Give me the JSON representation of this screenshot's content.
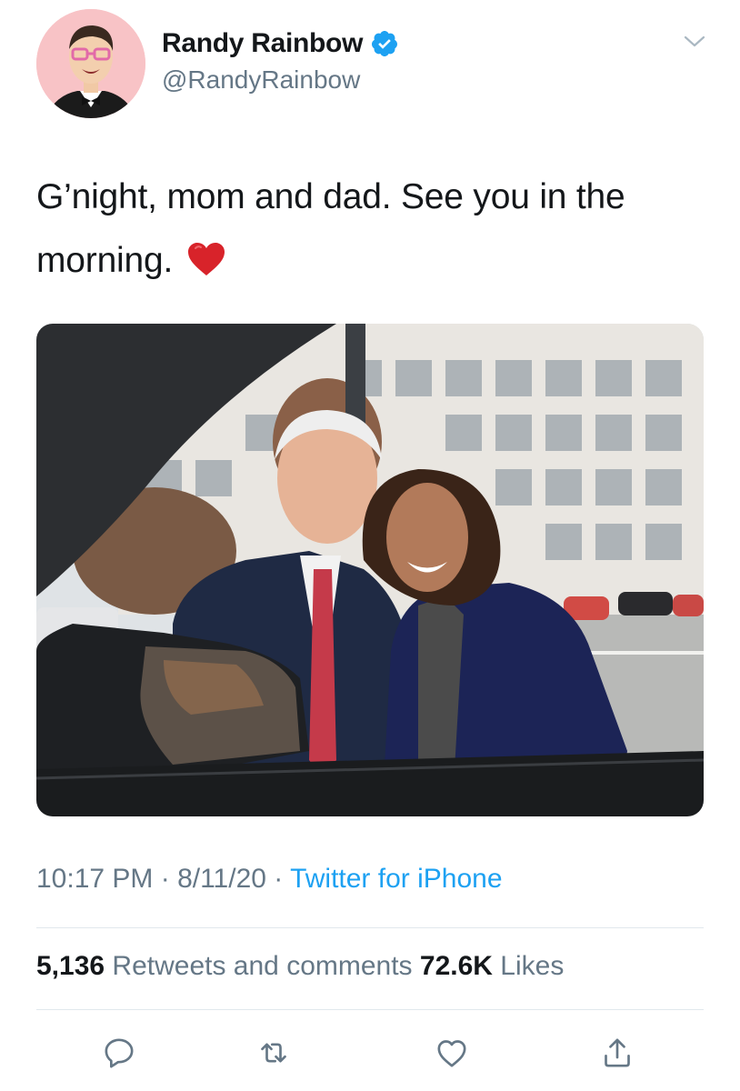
{
  "author": {
    "display_name": "Randy Rainbow",
    "handle": "@RandyRainbow",
    "verified": true
  },
  "tweet": {
    "text": "G’night, mom and dad. See you in the morning.",
    "emoji": "heart-emoji",
    "timestamp": "10:17 PM · 8/11/20 · ",
    "source": "Twitter for iPhone"
  },
  "stats": {
    "retweets_count": "5,136",
    "retweets_label": " Retweets and comments ",
    "likes_count": "72.6K",
    "likes_label": " Likes"
  },
  "actions": [
    {
      "name": "reply",
      "icon": "reply-icon"
    },
    {
      "name": "retweet",
      "icon": "retweet-icon"
    },
    {
      "name": "like",
      "icon": "heart-outline-icon"
    },
    {
      "name": "share",
      "icon": "share-icon"
    }
  ],
  "colors": {
    "link_blue": "#1da1f2",
    "secondary_text": "#657786",
    "primary_text": "#14171a",
    "divider": "#e1e8ed",
    "icon_gray": "#657786"
  }
}
